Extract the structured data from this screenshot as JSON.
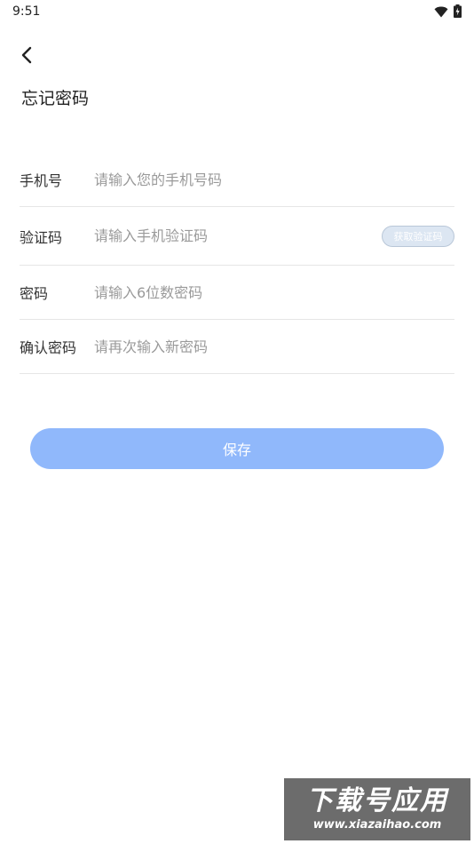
{
  "status_bar": {
    "time": "9:51",
    "wifi_icon": "wifi-icon",
    "battery_icon": "battery-charging-icon"
  },
  "header": {
    "back_icon": "chevron-left-icon",
    "title": "忘记密码"
  },
  "form": {
    "phone": {
      "label": "手机号",
      "placeholder": "请输入您的手机号码",
      "value": ""
    },
    "code": {
      "label": "验证码",
      "placeholder": "请输入手机验证码",
      "value": "",
      "button_label": "获取验证码"
    },
    "password": {
      "label": "密码",
      "placeholder": "请输入6位数密码",
      "value": ""
    },
    "confirm": {
      "label": "确认密码",
      "placeholder": "请再次输入新密码",
      "value": ""
    }
  },
  "actions": {
    "save_label": "保存"
  },
  "colors": {
    "primary_button": "#90b8fb",
    "code_button_bg": "#dce6f2",
    "divider": "#e6e6e6",
    "placeholder": "#9a9a9a"
  },
  "watermark": {
    "title": "下载号应用",
    "url": "www.xiazaihao.com"
  }
}
